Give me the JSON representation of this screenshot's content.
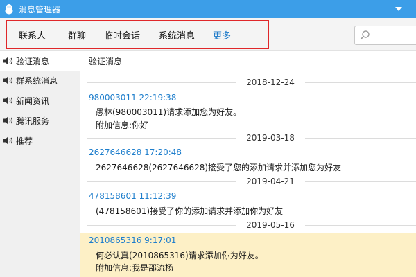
{
  "window": {
    "title": "消息管理器"
  },
  "tabs": [
    {
      "label": "联系人"
    },
    {
      "label": "群聊"
    },
    {
      "label": "临时会话"
    },
    {
      "label": "系统消息"
    },
    {
      "label": "更多"
    }
  ],
  "search": {
    "placeholder": ""
  },
  "sidebar": {
    "items": [
      {
        "label": "验证消息",
        "active": true
      },
      {
        "label": "群系统消息"
      },
      {
        "label": "新闻资讯"
      },
      {
        "label": "腾讯服务"
      },
      {
        "label": "推荐"
      }
    ]
  },
  "main": {
    "header": "验证消息",
    "dates": [
      "2018-12-24",
      "2019-03-18",
      "2019-04-21",
      "2019-05-16"
    ],
    "messages": [
      {
        "sender": "980003011 22:19:38",
        "line1": "愚林(980003011)请求添加您为好友。",
        "line2": "附加信息:你好"
      },
      {
        "sender": "2627646628 17:20:48",
        "line1": "2627646628(2627646628)接受了您的添加请求并添加您为好友"
      },
      {
        "sender": "478158601 11:12:39",
        "line1": "(478158601)接受了你的添加请求并添加你为好友"
      },
      {
        "sender": "2010865316 9:17:01",
        "line1": "何必认真(2010865316)请求添加你为好友。",
        "line2": "附加信息:我是邵流杨",
        "highlighted": true
      }
    ]
  },
  "colors": {
    "titlebar": "#3c9ee8",
    "link": "#1e7ecc",
    "highlight": "#fdf0c6",
    "tabs_border": "#e0272a"
  }
}
